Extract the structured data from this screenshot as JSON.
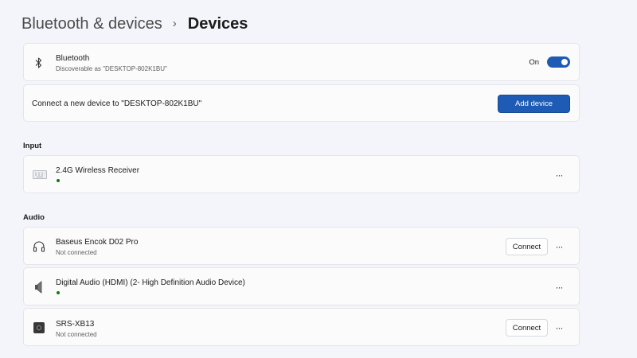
{
  "breadcrumb": {
    "parent": "Bluetooth & devices",
    "separator": "›",
    "current": "Devices"
  },
  "bluetooth": {
    "title": "Bluetooth",
    "subtitle": "Discoverable as \"DESKTOP-802K1BU\"",
    "toggle_label": "On",
    "toggle_on": true
  },
  "connect_new": {
    "text": "Connect a new device to \"DESKTOP-802K1BU\"",
    "button_label": "Add device"
  },
  "input": {
    "section_label": "Input",
    "devices": [
      {
        "name": "2.4G Wireless Receiver",
        "status": "connected",
        "icon": "keyboard-icon"
      }
    ]
  },
  "audio": {
    "section_label": "Audio",
    "devices": [
      {
        "name": "Baseus Encok D02 Pro",
        "status_text": "Not connected",
        "button_label": "Connect",
        "icon": "headphones-icon"
      },
      {
        "name": "Digital Audio (HDMI) (2- High Definition Audio Device)",
        "status": "connected",
        "icon": "speaker-icon"
      },
      {
        "name": "SRS-XB13",
        "status_text": "Not connected",
        "button_label": "Connect",
        "icon": "bluetooth-speaker-icon"
      }
    ]
  },
  "more_label": "···",
  "colors": {
    "accent": "#1e5bb5",
    "connected_dot": "#0e7a0d",
    "background": "#f3f5fa",
    "card": "#fbfbfc"
  }
}
